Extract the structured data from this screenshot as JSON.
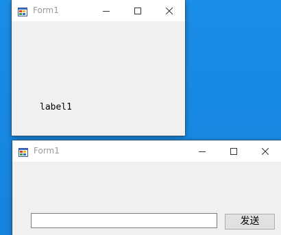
{
  "window_top": {
    "title": "Form1",
    "label_text": "label1"
  },
  "window_bottom": {
    "title": "Form1",
    "input_value": "",
    "send_label": "发送"
  },
  "icons": {
    "app": "winforms-app-icon",
    "minimize": "minimize-icon",
    "maximize": "maximize-icon",
    "close": "close-icon"
  },
  "colors": {
    "desktop": "#1889e3",
    "titlebar": "#ffffff",
    "client": "#f0f0f0",
    "title_text": "#9a9a9a",
    "button_face": "#e1e1e1"
  }
}
